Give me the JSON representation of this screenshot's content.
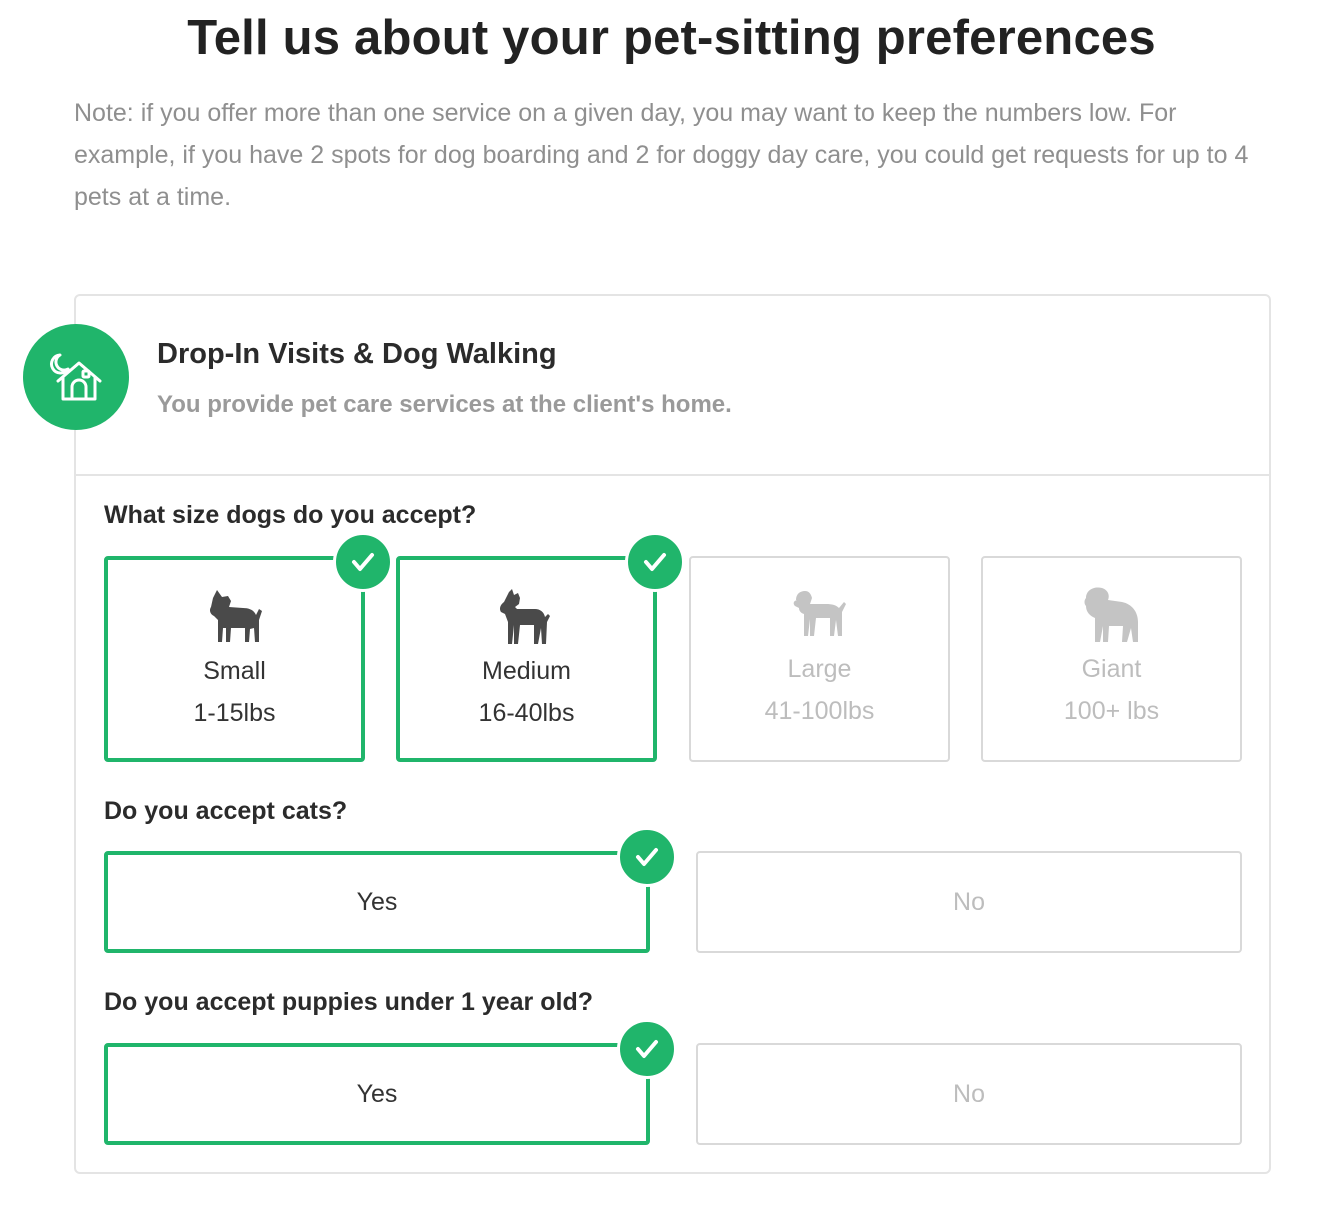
{
  "page": {
    "title": "Tell us about your pet-sitting preferences",
    "note": "Note: if you offer more than one service on a given day, you may want to keep the numbers low. For example, if you have 2 spots for dog boarding and 2 for doggy day care, you could get requests for up to 4 pets at a time."
  },
  "service": {
    "icon": "house-moon-icon",
    "title": "Drop-In Visits & Dog Walking",
    "subtitle": "You provide pet care services at the client's home."
  },
  "dog_sizes": {
    "question": "What size dogs do you accept?",
    "options": [
      {
        "label": "Small",
        "range": "1-15lbs",
        "selected": true,
        "icon": "small-dog-icon"
      },
      {
        "label": "Medium",
        "range": "16-40lbs",
        "selected": true,
        "icon": "medium-dog-icon"
      },
      {
        "label": "Large",
        "range": "41-100lbs",
        "selected": false,
        "icon": "large-dog-icon"
      },
      {
        "label": "Giant",
        "range": "100+ lbs",
        "selected": false,
        "icon": "giant-dog-icon"
      }
    ]
  },
  "cats": {
    "question": "Do you accept cats?",
    "yes": "Yes",
    "no": "No",
    "selected": "yes"
  },
  "puppies": {
    "question": "Do you accept puppies under 1 year old?",
    "yes": "Yes",
    "no": "No",
    "selected": "yes"
  },
  "colors": {
    "accent": "#20b56b",
    "border": "#d9d9d9",
    "muted_text": "#9a9a9a",
    "disabled_text": "#bdbdbd"
  }
}
